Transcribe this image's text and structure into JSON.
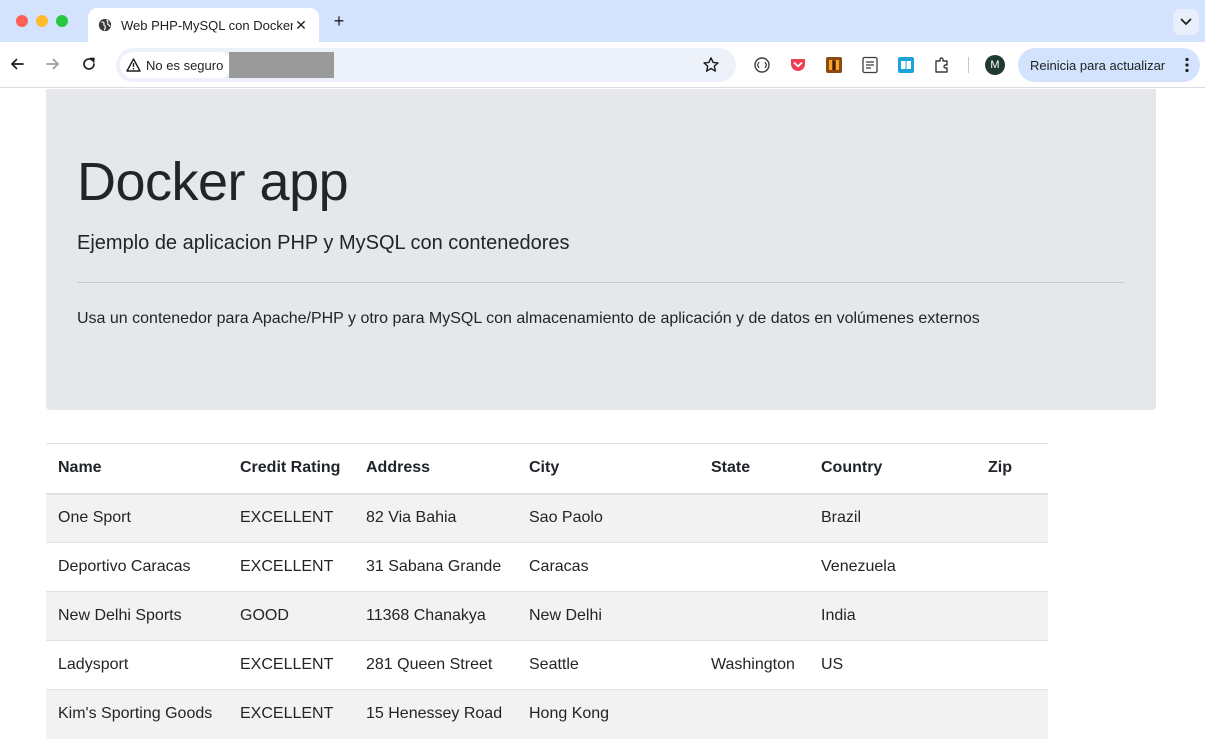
{
  "browser": {
    "tab_title": "Web PHP-MySQL con Docker",
    "tab_close": "✕",
    "new_tab": "+",
    "security_label": "No es seguro",
    "update_label": "Reinicia para actualizar",
    "profile_initial": "M",
    "extensions": [
      "ring-icon",
      "pocket-icon",
      "bookshelf-icon",
      "reader-icon",
      "book-icon",
      "puzzle-icon"
    ]
  },
  "page": {
    "title": "Docker app",
    "lead": "Ejemplo de aplicacion PHP y MySQL con contenedores",
    "description": "Usa un contenedor para Apache/PHP y otro para MySQL con almacenamiento de aplicación y de datos en volúmenes externos"
  },
  "table": {
    "columns": [
      "Name",
      "Credit Rating",
      "Address",
      "City",
      "State",
      "Country",
      "Zip"
    ],
    "rows": [
      [
        "One Sport",
        "EXCELLENT",
        "82 Via Bahia",
        "Sao Paolo",
        "",
        "Brazil",
        ""
      ],
      [
        "Deportivo Caracas",
        "EXCELLENT",
        "31 Sabana Grande",
        "Caracas",
        "",
        "Venezuela",
        ""
      ],
      [
        "New Delhi Sports",
        "GOOD",
        "11368 Chanakya",
        "New Delhi",
        "",
        "India",
        ""
      ],
      [
        "Ladysport",
        "EXCELLENT",
        "281 Queen Street",
        "Seattle",
        "Washington",
        "US",
        ""
      ],
      [
        "Kim's Sporting Goods",
        "EXCELLENT",
        "15 Henessey Road",
        "Hong Kong",
        "",
        "",
        ""
      ]
    ]
  }
}
